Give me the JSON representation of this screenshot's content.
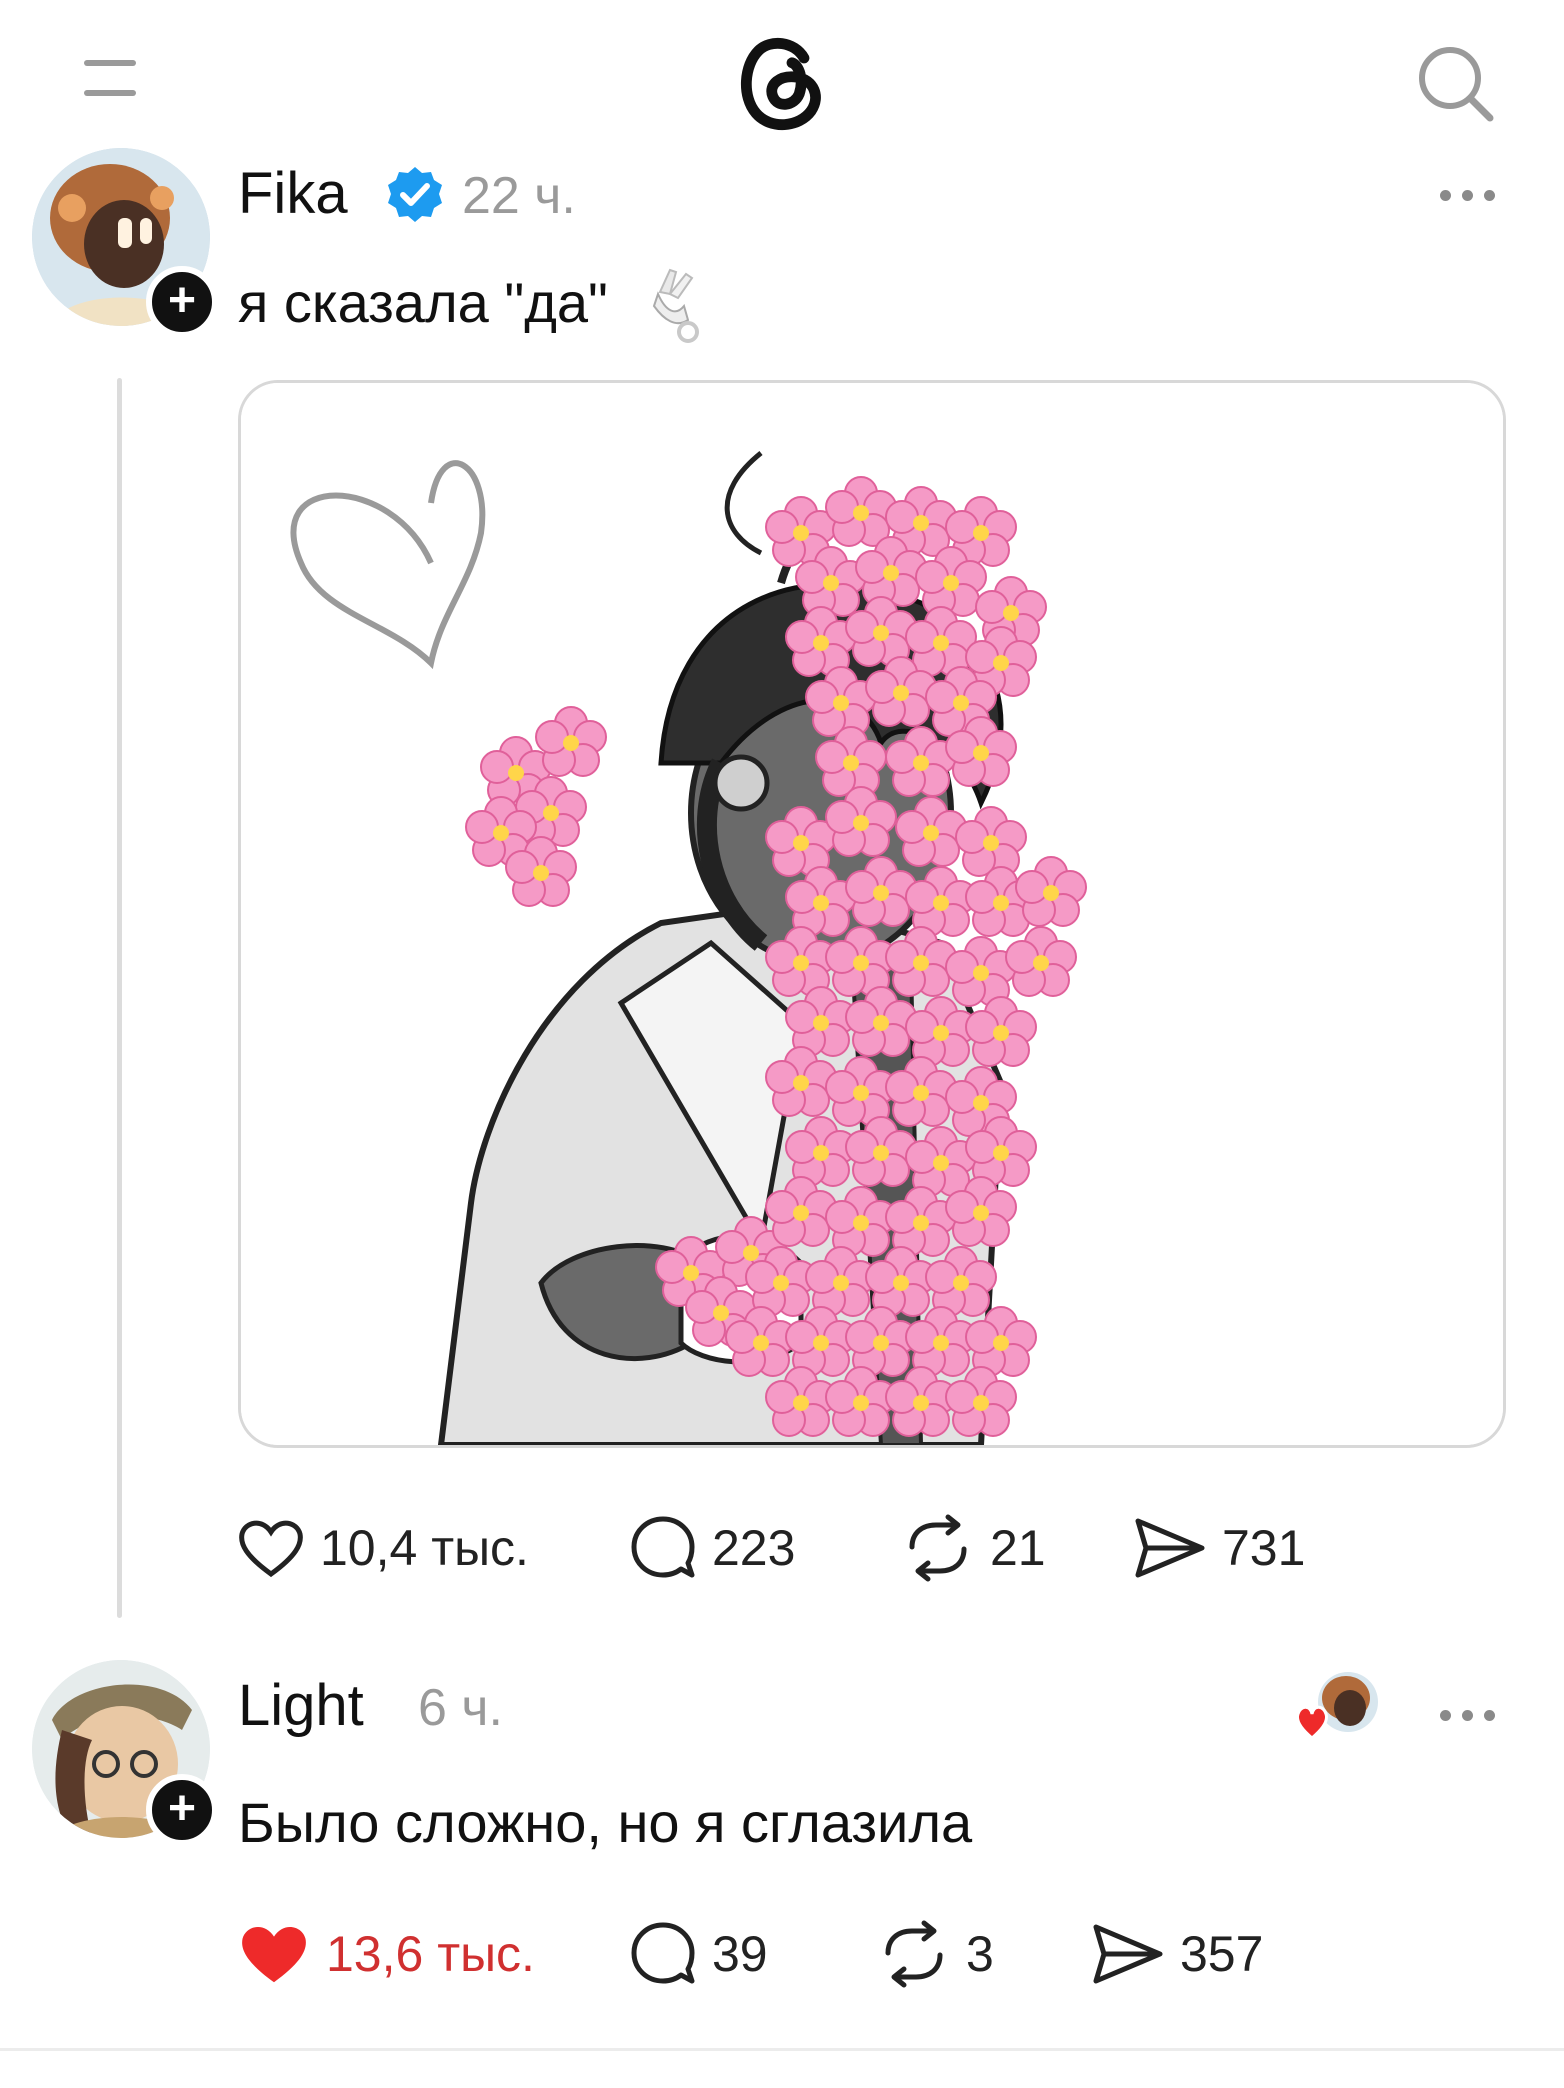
{
  "app": {
    "logo_icon": "threads-logo-icon",
    "menu_icon": "menu-icon",
    "search_icon": "search-icon"
  },
  "posts": [
    {
      "username": "Fika",
      "verified": true,
      "time": "22 ч.",
      "text": "я сказала \"да\"",
      "emoji": "hand-with-ring",
      "image_description_icon": "illustration-image",
      "actions": {
        "likes": "10,4 тыс.",
        "comments": "223",
        "reposts": "21",
        "shares": "731"
      },
      "liked": false
    },
    {
      "username": "Light",
      "verified": false,
      "time": "6 ч.",
      "text": "Было сложно, но я сглазила",
      "liked_by_author_icon": "author-avatar-heart-icon",
      "actions": {
        "likes": "13,6 тыс.",
        "comments": "39",
        "reposts": "3",
        "shares": "357"
      },
      "liked": true
    }
  ],
  "colors": {
    "verified": "#1d9bf0",
    "liked": "#ee2a2a",
    "muted": "#9a9a9a",
    "flower_pink": "#f59ac6"
  }
}
